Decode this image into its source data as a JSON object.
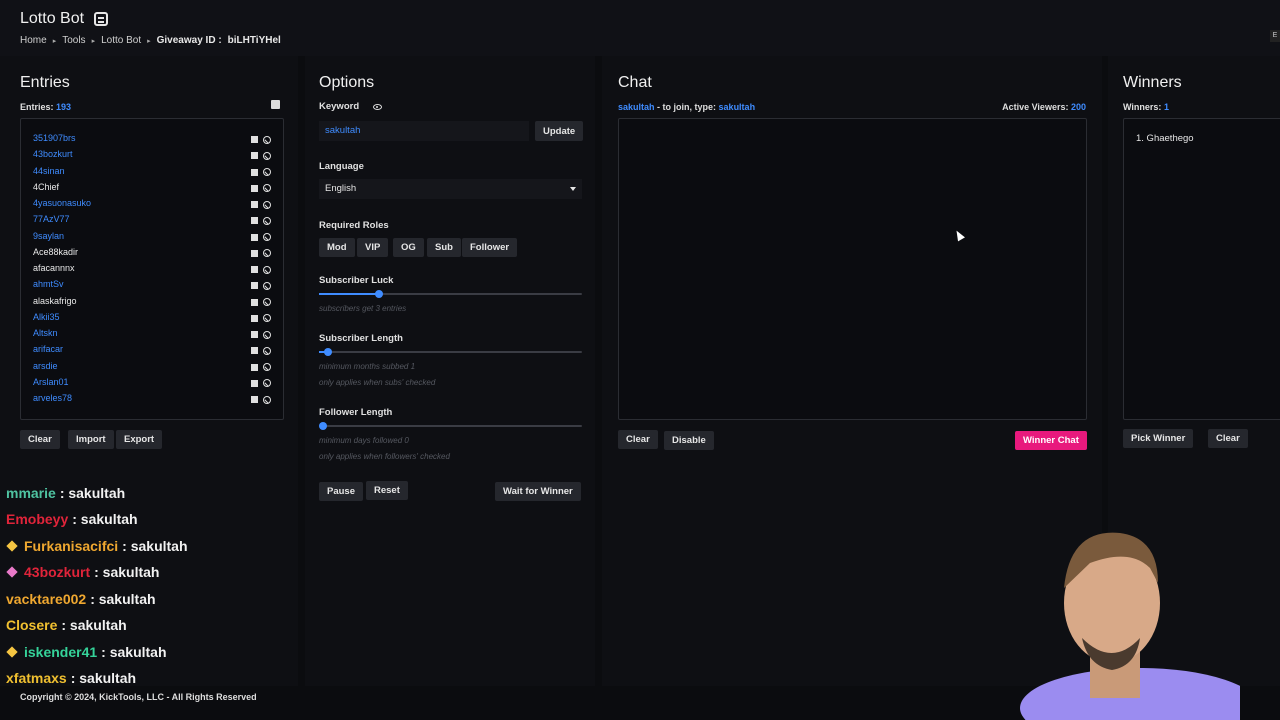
{
  "header": {
    "title": "Lotto Bot",
    "breadcrumb": [
      "Home",
      "Tools",
      "Lotto Bot"
    ],
    "giveaway_label": "Giveaway ID :",
    "giveaway_id": "biLHTiYHel",
    "corner_badge": "E"
  },
  "entries": {
    "title": "Entries",
    "count_label": "Entries:",
    "count": "193",
    "items": [
      {
        "name": "351907brs",
        "color": "#3f8cff"
      },
      {
        "name": "43bozkurt",
        "color": "#3f8cff"
      },
      {
        "name": "44sinan",
        "color": "#3f8cff"
      },
      {
        "name": "4Chief",
        "color": "#eaeaea"
      },
      {
        "name": "4yasuonasuko",
        "color": "#3f8cff"
      },
      {
        "name": "77AzV77",
        "color": "#3f8cff"
      },
      {
        "name": "9saylan",
        "color": "#3f8cff"
      },
      {
        "name": "Ace88kadir",
        "color": "#eaeaea"
      },
      {
        "name": "afacannnx",
        "color": "#eaeaea"
      },
      {
        "name": "ahmtSv",
        "color": "#3f8cff"
      },
      {
        "name": "alaskafrigo",
        "color": "#eaeaea"
      },
      {
        "name": "Alkii35",
        "color": "#3f8cff"
      },
      {
        "name": "Altskn",
        "color": "#3f8cff"
      },
      {
        "name": "arifacar",
        "color": "#3f8cff"
      },
      {
        "name": "arsdie",
        "color": "#3f8cff"
      },
      {
        "name": "Arslan01",
        "color": "#3f8cff"
      },
      {
        "name": "arveles78",
        "color": "#3f8cff"
      }
    ],
    "buttons": {
      "clear": "Clear",
      "import": "Import",
      "export": "Export"
    }
  },
  "overlay_chat": [
    {
      "user": "mmarie",
      "msg": ": sakultah",
      "color": "#4fc3a1",
      "badge": null
    },
    {
      "user": "Emobeyy",
      "msg": ": sakultah",
      "color": "#e0243a",
      "badge": null
    },
    {
      "user": "Furkanisacifci",
      "msg": ": sakultah",
      "color": "#f0a830",
      "badge": "#f5c542"
    },
    {
      "user": "43bozkurt",
      "msg": ": sakultah",
      "color": "#e0243a",
      "badge": "#e879c8"
    },
    {
      "user": "vacktare002",
      "msg": ": sakultah",
      "color": "#f0a830",
      "badge": null
    },
    {
      "user": "Closere",
      "msg": ": sakultah",
      "color": "#f0c030",
      "badge": null
    },
    {
      "user": "iskender41",
      "msg": ": sakultah",
      "color": "#35d39a",
      "badge": "#f5c542"
    },
    {
      "user": "xfatmaxs",
      "msg": ": sakultah",
      "color": "#f0c030",
      "badge": null
    }
  ],
  "options": {
    "title": "Options",
    "keyword_label": "Keyword",
    "keyword_value": "sakultah",
    "update_button": "Update",
    "language_label": "Language",
    "language_value": "English",
    "roles_label": "Required Roles",
    "roles": [
      "Mod",
      "VIP",
      "OG",
      "Sub",
      "Follower"
    ],
    "sub_luck_label": "Subscriber Luck",
    "sub_luck_value": 3,
    "sub_luck_hint": "subscribers get 3 entries",
    "sub_length_label": "Subscriber Length",
    "sub_length_value": 1,
    "sub_length_hint": "minimum months subbed 1",
    "sub_length_hint2": "only applies when subs' checked",
    "follower_length_label": "Follower Length",
    "follower_length_value": 0,
    "follower_length_hint": "minimum days followed 0",
    "follower_length_hint2": "only applies when followers' checked",
    "pause_button": "Pause",
    "reset_button": "Reset",
    "wait_button": "Wait for Winner"
  },
  "chat": {
    "title": "Chat",
    "join_user": "sakultah",
    "join_text": "- to join, type:",
    "join_keyword": "sakultah",
    "viewers_label": "Active Viewers:",
    "viewers_count": "200",
    "clear_button": "Clear",
    "disable_button": "Disable",
    "winner_chat_button": "Winner Chat"
  },
  "winners": {
    "title": "Winners",
    "count_label": "Winners:",
    "count": "1",
    "list": [
      "1.  Ghaethego"
    ],
    "pick_button": "Pick Winner",
    "clear_button": "Clear"
  },
  "footer": {
    "copyright": "Copyright © 2024, KickTools, LLC - All Rights Reserved"
  },
  "colors": {
    "accent_blue": "#3f8cff",
    "accent_pink": "#e8197d",
    "background": "#0b0c0f"
  }
}
